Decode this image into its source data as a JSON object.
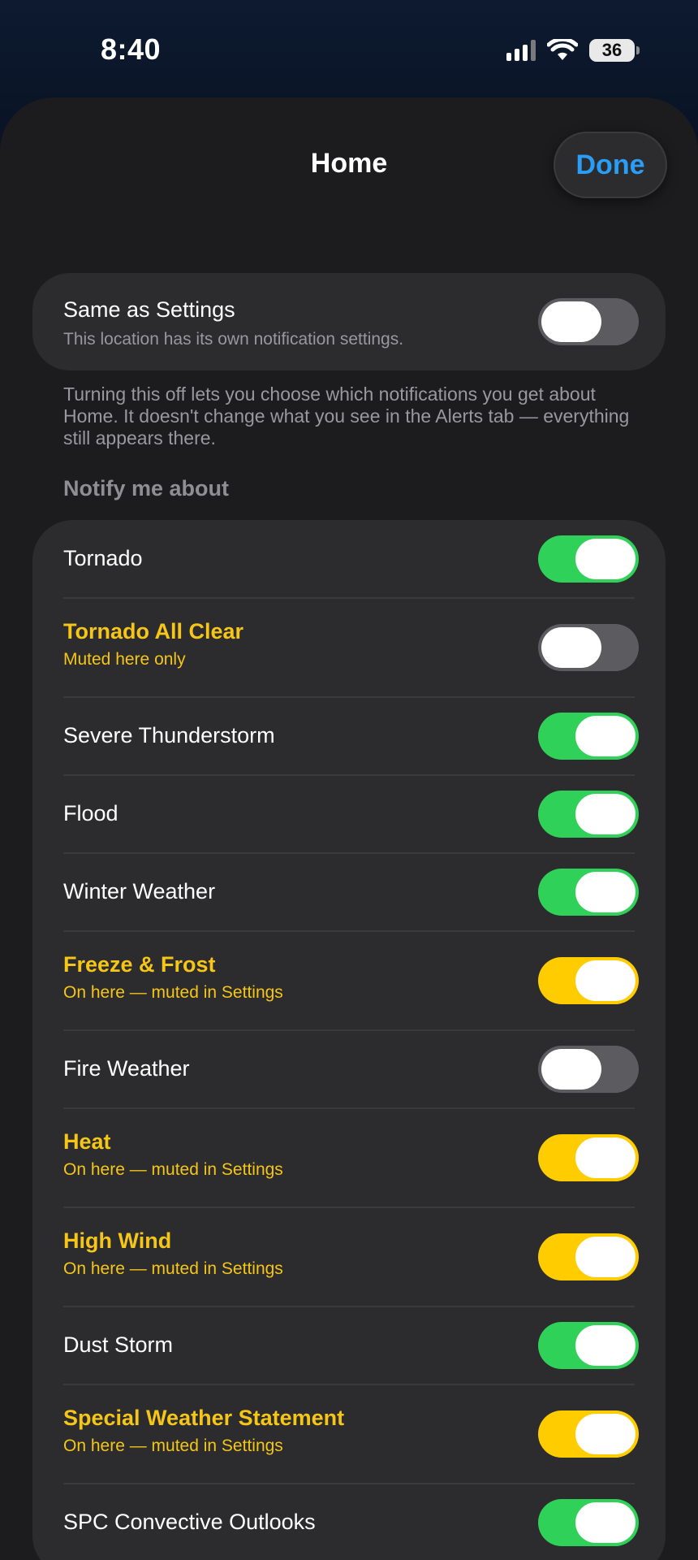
{
  "status_bar": {
    "time": "8:40",
    "battery": "36",
    "icons": [
      "cellular-signal-icon",
      "wifi-icon",
      "battery-icon"
    ]
  },
  "sheet": {
    "title": "Home",
    "done_label": "Done"
  },
  "same_as_settings": {
    "title": "Same as Settings",
    "subtitle": "This location has its own notification settings.",
    "enabled": false,
    "footer": "Turning this off lets you choose which notifications you get about Home. It doesn't change what you see in the Alerts tab — everything still appears there."
  },
  "notify": {
    "header": "Notify me about",
    "items": [
      {
        "label": "Tornado",
        "sub": "",
        "on": true,
        "style": "normal"
      },
      {
        "label": "Tornado All Clear",
        "sub": "Muted here only",
        "on": false,
        "style": "warn"
      },
      {
        "label": "Severe Thunderstorm",
        "sub": "",
        "on": true,
        "style": "normal"
      },
      {
        "label": "Flood",
        "sub": "",
        "on": true,
        "style": "normal"
      },
      {
        "label": "Winter Weather",
        "sub": "",
        "on": true,
        "style": "normal"
      },
      {
        "label": "Freeze & Frost",
        "sub": "On here — muted in Settings",
        "on": true,
        "style": "warn"
      },
      {
        "label": "Fire Weather",
        "sub": "",
        "on": false,
        "style": "normal"
      },
      {
        "label": "Heat",
        "sub": "On here — muted in Settings",
        "on": true,
        "style": "warn"
      },
      {
        "label": "High Wind",
        "sub": "On here — muted in Settings",
        "on": true,
        "style": "warn"
      },
      {
        "label": "Dust Storm",
        "sub": "",
        "on": true,
        "style": "normal"
      },
      {
        "label": "Special Weather Statement",
        "sub": "On here — muted in Settings",
        "on": true,
        "style": "warn"
      },
      {
        "label": "SPC Convective Outlooks",
        "sub": "",
        "on": true,
        "style": "normal"
      }
    ]
  },
  "colors": {
    "toggle_on": "#30d158",
    "toggle_warn": "#ffcc00",
    "toggle_off": "#5b5b60",
    "accent": "#2a9df4",
    "warn_text": "#f5c518"
  }
}
